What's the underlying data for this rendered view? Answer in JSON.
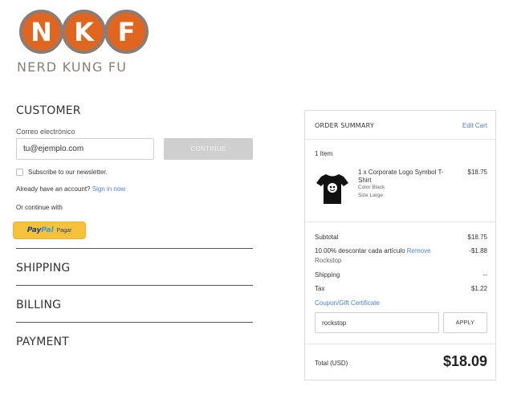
{
  "logo": {
    "letters": [
      "N",
      "K",
      "F"
    ],
    "tagline": "NERD KUNG FU",
    "colors": {
      "circle": "#e0661f",
      "ring": "#8a7d76"
    }
  },
  "customer": {
    "title": "CUSTOMER",
    "email_label": "Correo electrónico",
    "email_value": "tu@ejemplo.com",
    "continue_label": "CONTINUE",
    "newsletter_label": "Subscribe to our newsletter.",
    "account_prefix": "Already have an account?",
    "signin_label": "Sign in now",
    "continue_with": "Or continue with",
    "paypal": {
      "pay": "Pay",
      "pal": "Pal",
      "pagar": "Pagar"
    }
  },
  "sections": {
    "shipping": "SHIPPING",
    "billing": "BILLING",
    "payment": "PAYMENT"
  },
  "summary": {
    "title": "ORDER SUMMARY",
    "edit_cart": "Edit Cart",
    "item_count": "1 Item",
    "product": {
      "name": "1 x Corporate Logo Symbol T-Shirt",
      "color": "Color Black",
      "size": "Size Large",
      "price": "$18.75",
      "icon": "tshirt-icon"
    },
    "subtotal_label": "Subtotal",
    "subtotal_value": "$18.75",
    "discount_label": "10.00% descontar cada artículo",
    "discount_remove": "Remove",
    "discount_code": "Rockstop",
    "discount_value": "-$1.88",
    "shipping_label": "Shipping",
    "shipping_value": "--",
    "tax_label": "Tax",
    "tax_value": "$1.22",
    "coupon_label": "Coupon/Gift Certificate",
    "coupon_value": "rockstop",
    "apply_label": "APPLY",
    "total_label": "Total (USD)",
    "total_value": "$18.09"
  },
  "colors": {
    "link": "#4a7fd1",
    "paypal_yellow": "#f7c23a",
    "button_disabled": "#cfcfcf"
  }
}
